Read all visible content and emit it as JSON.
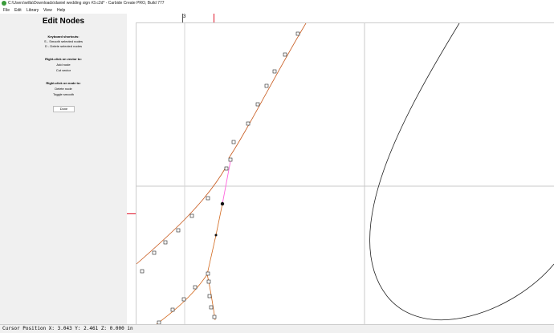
{
  "window": {
    "title": "C:\\Users\\willa\\Downloads\\daniel wedding sign #3.c2d* - Carbide Create PRO, Build 777"
  },
  "menu": {
    "items": [
      "File",
      "Edit",
      "Library",
      "View",
      "Help"
    ]
  },
  "panel": {
    "title": "Edit Nodes",
    "shortcuts_heading": "Keyboard shortcuts:",
    "shortcut_smooth": "S - Smooth selected nodes",
    "shortcut_delete": "D - Delete selected nodes",
    "vector_heading": "Right-click on vector to:",
    "vector_add": "Add node",
    "vector_cut": "Cut vector",
    "node_heading": "Right-click on node to:",
    "node_delete": "Delete node",
    "node_toggle": "Toggle smooth",
    "done_label": "Done"
  },
  "ruler": {
    "top_label": "3"
  },
  "status": {
    "cursor_position": "Cursor Position X: 3.043 Y: 2.461 Z: 0.000 in"
  },
  "colors": {
    "accent_red": "#e0142a",
    "path_orange": "#d2691e",
    "path_selected": "#ff66dd",
    "ellipse": "#222222"
  },
  "icons": {
    "app": "carbide-create-icon"
  }
}
